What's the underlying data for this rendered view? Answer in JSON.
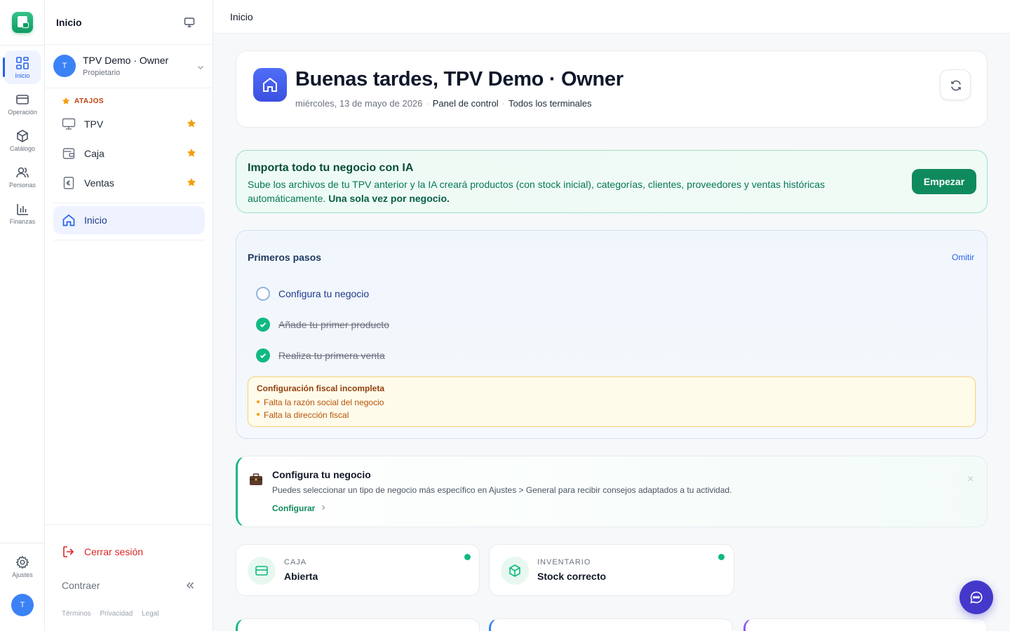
{
  "rail": {
    "items": [
      {
        "label": "Inicio",
        "icon": "grid-icon",
        "active": true
      },
      {
        "label": "Operación",
        "icon": "card-icon"
      },
      {
        "label": "Catálogo",
        "icon": "box-icon"
      },
      {
        "label": "Personas",
        "icon": "users-icon"
      },
      {
        "label": "Finanzas",
        "icon": "bars-icon"
      }
    ],
    "settings_label": "Ajustes",
    "avatar_initial": "T"
  },
  "sidebar": {
    "title": "Inicio",
    "user": {
      "initial": "T",
      "name": "TPV Demo · Owner",
      "role": "Propietario"
    },
    "shortcuts_label": "ATAJOS",
    "shortcuts": [
      {
        "label": "TPV",
        "icon": "monitor-icon"
      },
      {
        "label": "Caja",
        "icon": "wallet-icon"
      },
      {
        "label": "Ventas",
        "icon": "euro-receipt-icon"
      }
    ],
    "active_item": "Inicio",
    "logout": "Cerrar sesión",
    "collapse": "Contraer",
    "footer_links": [
      "Términos",
      "Privacidad",
      "Legal"
    ]
  },
  "topbar": {
    "title": "Inicio"
  },
  "hero": {
    "title": "Buenas tardes, TPV Demo · Owner",
    "date": "miércoles, 13 de mayo de 2026",
    "panel": "Panel de control",
    "terminals": "Todos los terminales"
  },
  "ai_banner": {
    "title": "Importa todo tu negocio con IA",
    "text": "Sube los archivos de tu TPV anterior y la IA creará productos (con stock inicial), categorías, clientes, proveedores y ventas históricas automáticamente.",
    "text_bold": "Una sola vez por negocio.",
    "button": "Empezar"
  },
  "steps": {
    "title": "Primeros pasos",
    "skip": "Omitir",
    "items": [
      {
        "label": "Configura tu negocio",
        "done": false
      },
      {
        "label": "Añade tu primer producto",
        "done": true
      },
      {
        "label": "Realiza tu primera venta",
        "done": true
      }
    ],
    "fiscal": {
      "title": "Configuración fiscal incompleta",
      "items": [
        "Falta la razón social del negocio",
        "Falta la dirección fiscal"
      ]
    }
  },
  "tip": {
    "title": "Configura tu negocio",
    "text": "Puedes seleccionar un tipo de negocio más específico en Ajustes > General para recibir consejos adaptados a tu actividad.",
    "link": "Configurar",
    "close": "×"
  },
  "stats": [
    {
      "label": "CAJA",
      "value": "Abierta",
      "icon": "card-icon",
      "status_color": "#10b981"
    },
    {
      "label": "INVENTARIO",
      "value": "Stock correcto",
      "icon": "box-icon",
      "status_color": "#10b981"
    }
  ],
  "colors": {
    "brand": "#10b981",
    "accent": "#2563eb",
    "danger": "#dc2626",
    "warning": "#f59e0b"
  }
}
